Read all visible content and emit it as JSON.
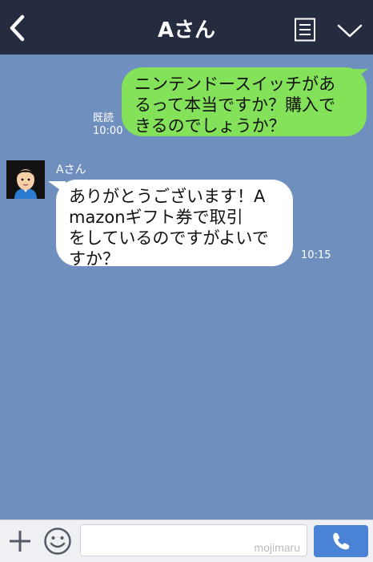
{
  "header": {
    "title": "Aさん",
    "back_icon": "chevron-left-icon",
    "menu_icon": "notes-menu-icon",
    "dropdown_icon": "chevron-down-icon"
  },
  "messages": [
    {
      "direction": "outgoing",
      "lines": [
        "ニンテンドースイッチがあ",
        "るって本当ですか？購入で",
        "きるのでしょうか？"
      ],
      "read_label": "既読",
      "time": "10:00"
    },
    {
      "direction": "incoming",
      "sender": "Aさん",
      "lines": [
        "ありがとうございます！A",
        "mazonギフト券で取引",
        "をしているのですがよいで",
        "すか？"
      ],
      "time": "10:15"
    }
  ],
  "footer": {
    "add_icon": "plus-icon",
    "emoji_icon": "smiley-icon",
    "input_value": "",
    "watermark": "mojimaru",
    "call_icon": "phone-icon"
  },
  "colors": {
    "header_bg": "#252c40",
    "chat_bg": "#6f8fbf",
    "outgoing_bubble": "#83e15a",
    "incoming_bubble": "#ffffff",
    "call_button": "#4a82d6"
  }
}
